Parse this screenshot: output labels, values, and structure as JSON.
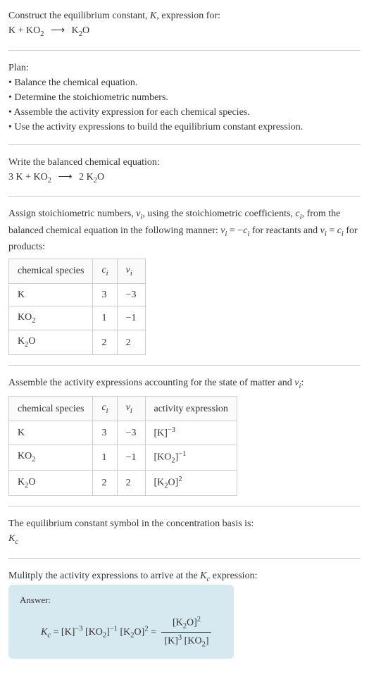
{
  "intro": {
    "line1": "Construct the equilibrium constant, ",
    "line1_k": "K",
    "line1_end": ", expression for:",
    "reaction_lhs1": "K + KO",
    "reaction_sub1": "2",
    "reaction_arrow": "⟶",
    "reaction_rhs1": "K",
    "reaction_rhs_sub": "2",
    "reaction_rhs2": "O"
  },
  "plan": {
    "title": "Plan:",
    "b1": "• Balance the chemical equation.",
    "b2": "• Determine the stoichiometric numbers.",
    "b3": "• Assemble the activity expression for each chemical species.",
    "b4": "• Use the activity expressions to build the equilibrium constant expression."
  },
  "balanced": {
    "title": "Write the balanced chemical equation:",
    "eq_l": "3 K + KO",
    "eq_lsub": "2",
    "eq_arrow": "⟶",
    "eq_r1": "2 K",
    "eq_rsub": "2",
    "eq_r2": "O"
  },
  "stoich": {
    "text1": "Assign stoichiometric numbers, ",
    "nu": "ν",
    "sub_i": "i",
    "text2": ", using the stoichiometric coefficients, ",
    "c": "c",
    "text3": ", from the balanced chemical equation in the following manner: ",
    "eq1a": "ν",
    "eq1b": " = −",
    "eq1c": "c",
    "text4": " for reactants and ",
    "eq2a": "ν",
    "eq2b": " = ",
    "eq2c": "c",
    "text5": " for products:",
    "table": {
      "h1": "chemical species",
      "h2_c": "c",
      "h2_i": "i",
      "h3_nu": "ν",
      "h3_i": "i",
      "rows": [
        {
          "sp": "K",
          "sp_sub": "",
          "c": "3",
          "nu": "−3"
        },
        {
          "sp": "KO",
          "sp_sub": "2",
          "c": "1",
          "nu": "−1"
        },
        {
          "sp": "K",
          "sp_sub": "2",
          "sp_end": "O",
          "c": "2",
          "nu": "2"
        }
      ]
    }
  },
  "activity": {
    "title1": "Assemble the activity expressions accounting for the state of matter and ",
    "nu": "ν",
    "sub_i": "i",
    "title2": ":",
    "table": {
      "h1": "chemical species",
      "h2_c": "c",
      "h2_i": "i",
      "h3_nu": "ν",
      "h3_i": "i",
      "h4": "activity expression",
      "r1": {
        "sp": "K",
        "c": "3",
        "nu": "−3",
        "ae_base": "[K]",
        "ae_exp": "−3"
      },
      "r2": {
        "sp1": "KO",
        "sp_sub": "2",
        "c": "1",
        "nu": "−1",
        "ae1": "[KO",
        "ae_sub": "2",
        "ae2": "]",
        "ae_exp": "−1"
      },
      "r3": {
        "sp1": "K",
        "sp_sub": "2",
        "sp2": "O",
        "c": "2",
        "nu": "2",
        "ae1": "[K",
        "ae_sub": "2",
        "ae2": "O]",
        "ae_exp": "2"
      }
    }
  },
  "symbol": {
    "text": "The equilibrium constant symbol in the concentration basis is:",
    "k": "K",
    "sub": "c"
  },
  "multiply": {
    "text1": "Mulitply the activity expressions to arrive at the ",
    "k": "K",
    "sub": "c",
    "text2": " expression:"
  },
  "answer": {
    "label": "Answer:",
    "kc_k": "K",
    "kc_sub": "c",
    "eq": " = ",
    "t1_base": "[K]",
    "t1_exp": "−3",
    "t2_a": " [KO",
    "t2_sub": "2",
    "t2_b": "]",
    "t2_exp": "−1",
    "t3_a": " [K",
    "t3_sub": "2",
    "t3_b": "O]",
    "t3_exp": "2",
    "eq2": " = ",
    "num_a": "[K",
    "num_sub": "2",
    "num_b": "O]",
    "num_exp": "2",
    "den_a": "[K]",
    "den_exp": "3",
    "den_b": " [KO",
    "den_sub": "2",
    "den_c": "]"
  }
}
